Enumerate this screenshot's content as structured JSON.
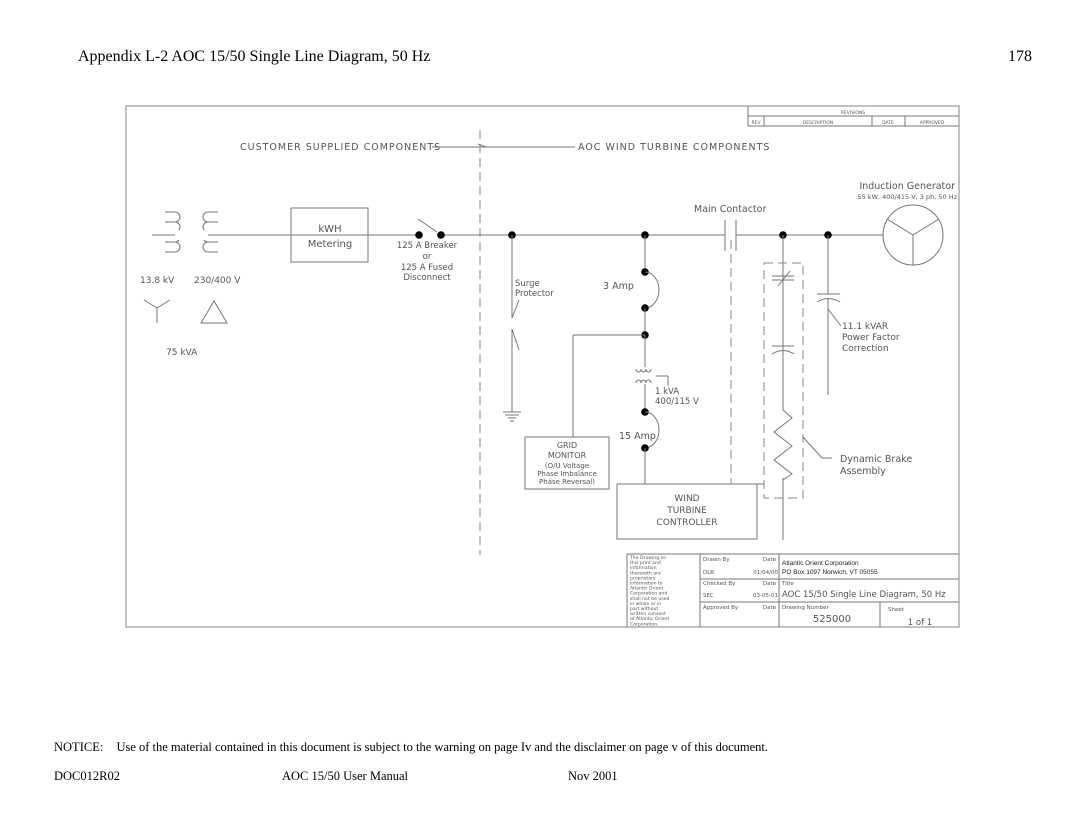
{
  "page": {
    "header": "Appendix L-2   AOC 15/50 Single Line Diagram, 50 Hz",
    "page_number": "178",
    "notice_label": "NOTICE:",
    "notice_text": "Use of the material contained in this document is subject to the warning on page Iv and the disclaimer on page v of this document.",
    "footer": {
      "doc_id": "DOC012R02",
      "manual": "AOC 15/50 User Manual",
      "date": "Nov 2001"
    }
  },
  "revisions": {
    "title": "REVISIONS",
    "columns": [
      "REV",
      "DESCRIPTION",
      "DATE",
      "APPROVED"
    ]
  },
  "diagram": {
    "section_left": "CUSTOMER SUPPLIED COMPONENTS",
    "section_right": "AOC WIND TURBINE COMPONENTS",
    "transformer": {
      "primary_voltage": "13.8 kV",
      "secondary_voltage": "230/400 V",
      "rating": "75 kVA"
    },
    "meter": [
      "kWH",
      "Metering"
    ],
    "breaker": [
      "125 A Breaker",
      "or",
      "125 A Fused",
      "Disconnect"
    ],
    "surge_protector": [
      "Surge",
      "Protector"
    ],
    "fuse_3a": "3 Amp",
    "fuse_15a": "15 Amp",
    "control_transformer": [
      "1 kVA",
      "400/115  V"
    ],
    "grid_monitor": [
      "GRID",
      "MONITOR",
      "(O/U Voltage",
      "Phase Imbalance",
      "Phase Reversal)"
    ],
    "controller": [
      "WIND",
      "TURBINE",
      "CONTROLLER"
    ],
    "main_contactor": "Main Contactor",
    "generator": [
      "Induction Generator",
      "55 kW, 400/415 V, 3 ph, 50 Hz"
    ],
    "pf_correction": [
      "11.1 kVAR",
      "Power Factor",
      "Correction"
    ],
    "dynamic_brake": [
      "Dynamic Brake",
      "Assembly"
    ]
  },
  "title_block": {
    "notice": [
      "The Drawing on",
      "this print and",
      "information",
      "therewith are",
      "proprietary",
      "information to",
      "Atlantic Orient",
      "Corporation and",
      "shall not be used",
      "in whole or in",
      "part without",
      "written consent",
      "of Atlantic Orient",
      "Corporation."
    ],
    "drawn_by_label": "Drawn By",
    "drawn_by": "DLB",
    "drawn_date": "01/04/00",
    "checked_by_label": "Checked By",
    "checked_by": "SEC",
    "checked_date": "03-05-01",
    "approved_by_label": "Approved By",
    "date_label": "Date",
    "company": "Atlantic Orient Corporation",
    "address": "PO Box 1097 Norwich, VT 05055",
    "title_label": "Title",
    "title": "AOC 15/50 Single Line Diagram, 50 Hz",
    "drawing_number_label": "Drawing Number",
    "drawing_number": "525000",
    "sheet_label": "Sheet",
    "sheet": "1 of 1"
  }
}
